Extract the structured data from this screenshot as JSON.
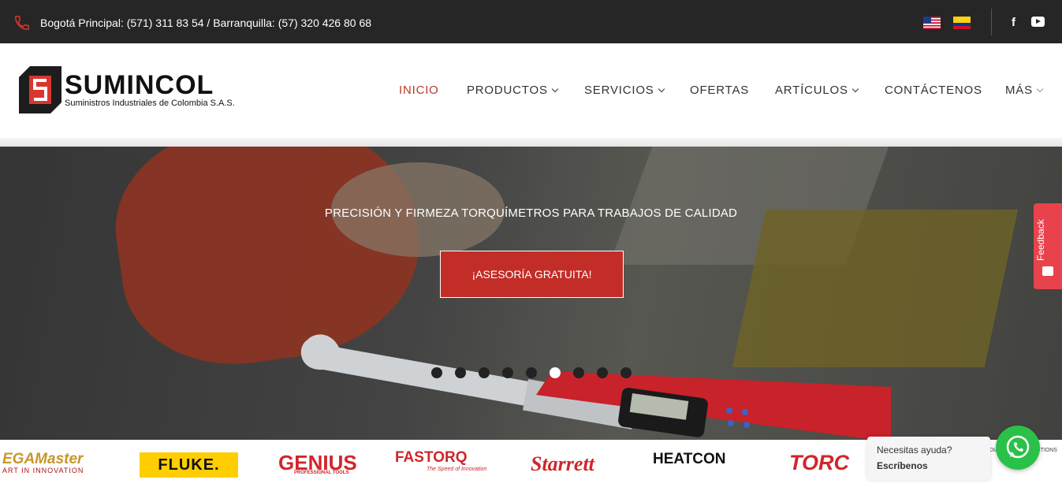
{
  "topbar": {
    "contact": "Bogotá Principal: (571) 311 83 54 / Barranquilla: (57) 320 426 80 68",
    "icons": [
      "phone-icon",
      "flag-us-icon",
      "flag-colombia-icon",
      "facebook-icon",
      "youtube-icon"
    ]
  },
  "logo": {
    "title": "SUMINCOL",
    "subtitle": "Suministros Industriales de Colombia S.A.S."
  },
  "nav": {
    "items": [
      {
        "label": "INICIO",
        "active": true
      },
      {
        "label": "PRODUCTOS",
        "dropdown": true
      },
      {
        "label": "SERVICIOS",
        "dropdown": true
      },
      {
        "label": "OFERTAS"
      },
      {
        "label": "ARTÍCULOS",
        "dropdown": true
      },
      {
        "label": "CONTÁCTENOS"
      },
      {
        "label": "MÁS",
        "dropdown": true
      }
    ]
  },
  "hero": {
    "caption": "PRECISIÓN Y FIRMEZA TORQUÍMETROS PARA TRABAJOS DE CALIDAD",
    "cta": "¡ASESORÍA GRATUITA!",
    "dots_total": 9,
    "active_dot": 6
  },
  "feedback": {
    "label": "Feedback"
  },
  "brands": {
    "ega": {
      "name": "EGAMaster",
      "tagline": "ART IN INNOVATION"
    },
    "fluke": {
      "name": "FLUKE."
    },
    "genius": {
      "name": "GENIUS",
      "tagline": "PROFESSIONAL TOOLS"
    },
    "fastorq": {
      "name": "FASTORQ",
      "tagline": "The Speed of Innovation"
    },
    "starrett": {
      "name": "Starrett"
    },
    "heatcon": {
      "name": "HEATCON"
    },
    "torc": {
      "name": "TORC"
    },
    "diagnostic": {
      "name": "DIAGNOSTIC SOLUTIONS"
    }
  },
  "chat": {
    "question": "Necesitas ayuda?",
    "action": "Escríbenos"
  },
  "colors": {
    "accent": "#c32d27",
    "topbar": "#262626",
    "nav_active": "#b93a2c",
    "whatsapp": "#2ac149",
    "feedback": "#e8434d"
  }
}
